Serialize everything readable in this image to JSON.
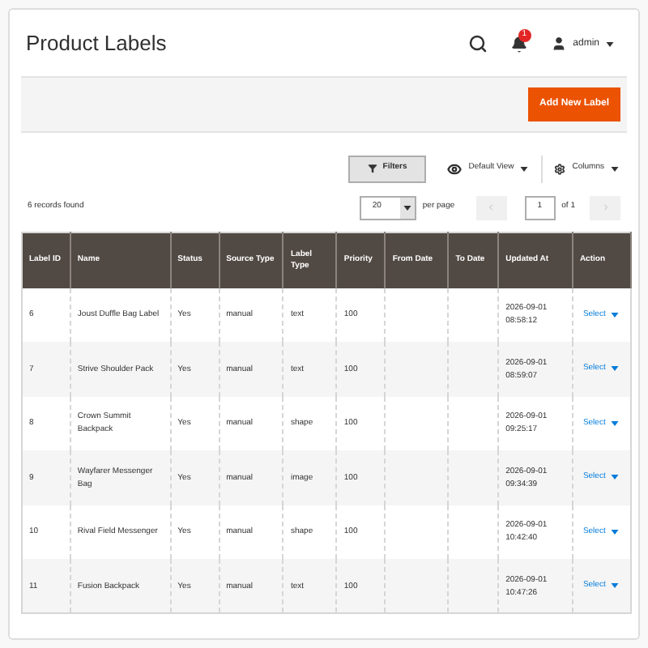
{
  "page": {
    "title": "Product Labels"
  },
  "header": {
    "notification_count": "1",
    "user": "admin"
  },
  "actions": {
    "add_button": "Add New Label"
  },
  "toolbar": {
    "filters": "Filters",
    "view": "Default View",
    "columns": "Columns"
  },
  "pager": {
    "records": "6 records found",
    "per_page_value": "20",
    "per_page_label": "per page",
    "page": "1",
    "of": "of 1"
  },
  "table": {
    "columns": [
      "Label ID",
      "Name",
      "Status",
      "Source Type",
      "Label Type",
      "Priority",
      "From Date",
      "To Date",
      "Updated At",
      "Action"
    ],
    "rows": [
      {
        "cells": [
          "6",
          "Joust Duffle Bag Label",
          "Yes",
          "manual",
          "text",
          "100",
          "",
          "",
          "2026-09-01 08:58:12"
        ],
        "action": "Select"
      },
      {
        "cells": [
          "7",
          "Strive Shoulder Pack",
          "Yes",
          "manual",
          "text",
          "100",
          "",
          "",
          "2026-09-01 08:59:07"
        ],
        "action": "Select"
      },
      {
        "cells": [
          "8",
          "Crown Summit Backpack",
          "Yes",
          "manual",
          "shape",
          "100",
          "",
          "",
          "2026-09-01 09:25:17"
        ],
        "action": "Select"
      },
      {
        "cells": [
          "9",
          "Wayfarer Messenger Bag",
          "Yes",
          "manual",
          "image",
          "100",
          "",
          "",
          "2026-09-01 09:34:39"
        ],
        "action": "Select"
      },
      {
        "cells": [
          "10",
          "Rival Field Messenger",
          "Yes",
          "manual",
          "shape",
          "100",
          "",
          "",
          "2026-09-01 10:42:40"
        ],
        "action": "Select"
      },
      {
        "cells": [
          "11",
          "Fusion Backpack",
          "Yes",
          "manual",
          "text",
          "100",
          "",
          "",
          "2026-09-01 10:47:26"
        ],
        "action": "Select"
      }
    ]
  }
}
